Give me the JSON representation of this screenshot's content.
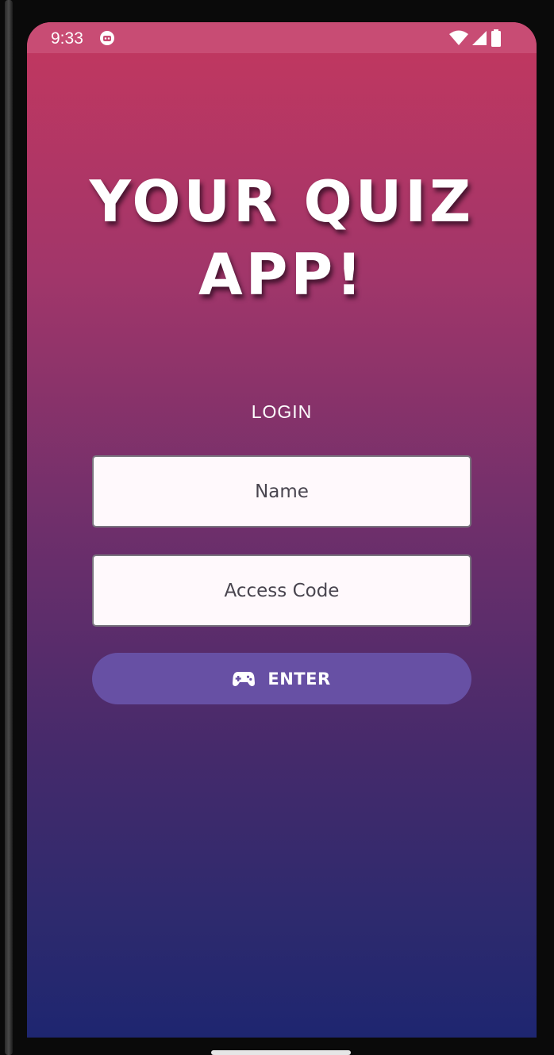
{
  "status_bar": {
    "time": "9:33",
    "app_icon": "robot-face-icon",
    "icons": [
      "wifi-icon",
      "cell-signal-icon",
      "battery-icon"
    ]
  },
  "title": {
    "line1": "YOUR QUIZ",
    "line2": "APP!"
  },
  "login": {
    "label": "LOGIN",
    "name_placeholder": "Name",
    "name_value": "",
    "code_placeholder": "Access Code",
    "code_value": "",
    "enter_label": "ENTER",
    "enter_icon": "gamepad-icon"
  },
  "colors": {
    "gradient_top": "#c3375f",
    "gradient_bottom": "#1e2670",
    "button": "#6750a4",
    "field_background": "#fff9fc",
    "status_bar": "#c84c74"
  }
}
